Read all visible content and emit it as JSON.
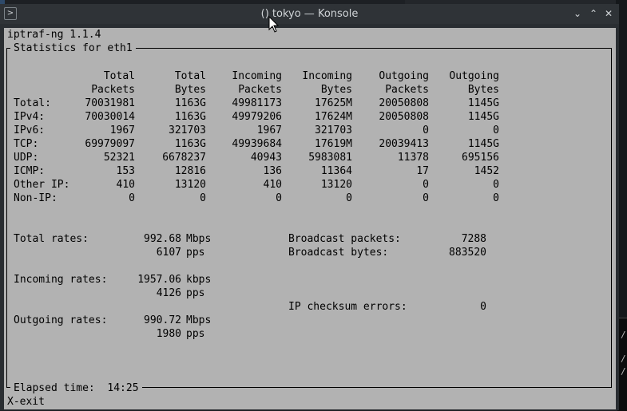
{
  "window": {
    "title": "() tokyo — Konsole",
    "app_icon": "terminal-icon",
    "buttons": [
      "chevron-down-icon",
      "chevron-up-icon",
      "close-icon"
    ]
  },
  "terminal": {
    "app_name": "iptraf-ng 1.1.4",
    "box_title": "Statistics for eth1",
    "headers": [
      [
        "Total",
        "Packets"
      ],
      [
        "Total",
        "Bytes"
      ],
      [
        "Incoming",
        "Packets"
      ],
      [
        "Incoming",
        "Bytes"
      ],
      [
        "Outgoing",
        "Packets"
      ],
      [
        "Outgoing",
        "Bytes"
      ]
    ],
    "rows": [
      {
        "label": "Total:",
        "values": [
          "70031981",
          "1163G",
          "49981173",
          "17625M",
          "20050808",
          "1145G"
        ]
      },
      {
        "label": "IPv4:",
        "values": [
          "70030014",
          "1163G",
          "49979206",
          "17624M",
          "20050808",
          "1145G"
        ]
      },
      {
        "label": "IPv6:",
        "values": [
          "1967",
          "321703",
          "1967",
          "321703",
          "0",
          "0"
        ]
      },
      {
        "label": "TCP:",
        "values": [
          "69979097",
          "1163G",
          "49939684",
          "17619M",
          "20039413",
          "1145G"
        ]
      },
      {
        "label": "UDP:",
        "values": [
          "52321",
          "6678237",
          "40943",
          "5983081",
          "11378",
          "695156"
        ]
      },
      {
        "label": "ICMP:",
        "values": [
          "153",
          "12816",
          "136",
          "11364",
          "17",
          "1452"
        ]
      },
      {
        "label": "Other IP:",
        "values": [
          "410",
          "13120",
          "410",
          "13120",
          "0",
          "0"
        ]
      },
      {
        "label": "Non-IP:",
        "values": [
          "0",
          "0",
          "0",
          "0",
          "0",
          "0"
        ]
      }
    ],
    "rates": {
      "total_label": "Total rates:",
      "total_value1": "992.68",
      "total_unit1": "Mbps",
      "total_value2": "6107",
      "total_unit2": "pps",
      "incoming_label": "Incoming rates:",
      "incoming_value1": "1957.06",
      "incoming_unit1": "kbps",
      "incoming_value2": "4126",
      "incoming_unit2": "pps",
      "outgoing_label": "Outgoing rates:",
      "outgoing_value1": "990.72",
      "outgoing_unit1": "Mbps",
      "outgoing_value2": "1980",
      "outgoing_unit2": "pps"
    },
    "broadcast": {
      "packets_label": "Broadcast packets:",
      "packets_value": "7288",
      "bytes_label": "Broadcast bytes:",
      "bytes_value": "883520"
    },
    "checksum": {
      "label": "IP checksum errors:",
      "value": "0"
    },
    "elapsed": {
      "label": "Elapsed time:",
      "value": "14:25"
    },
    "footer": "X-exit"
  }
}
